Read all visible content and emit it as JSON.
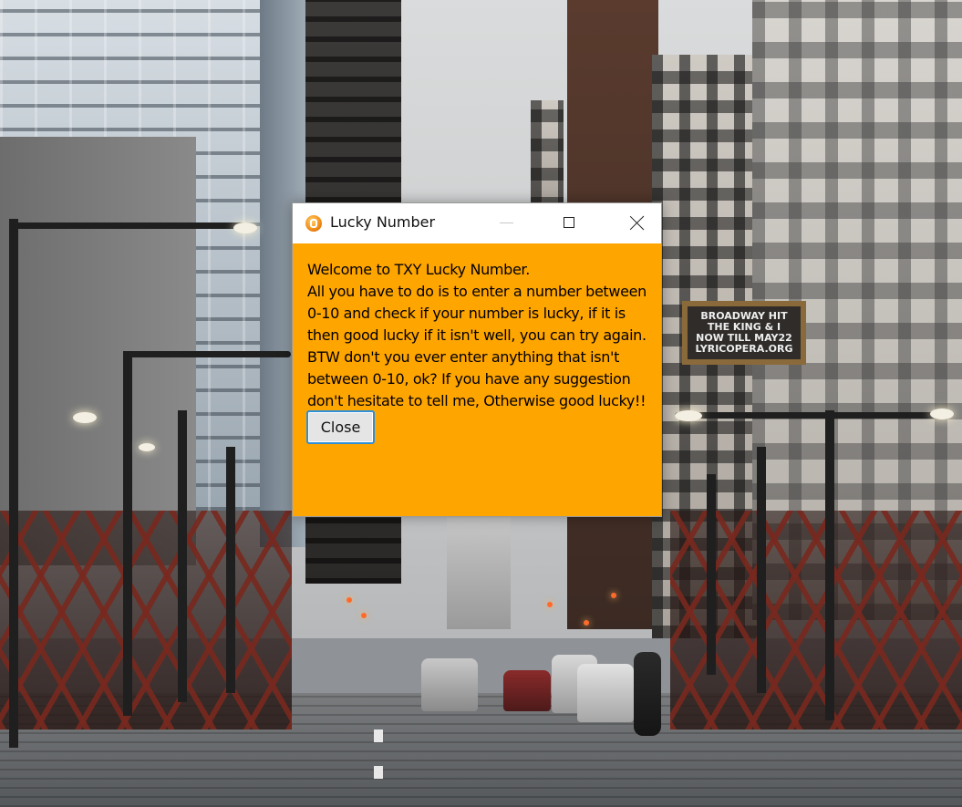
{
  "window": {
    "title": "Lucky Number",
    "background_color": "#FFA500",
    "controls": {
      "minimize": "minimize-icon",
      "maximize": "maximize-icon",
      "close": "close-icon"
    }
  },
  "dialog": {
    "message_lines": [
      "Welcome to TXY Lucky Number.",
      "All you have to do is to enter a number between",
      "0-10 and check if your number is lucky, if it is",
      "then good lucky if it isn't well, you can try again.",
      "BTW don't you ever enter anything that isn't",
      "between 0-10, ok? If you have any suggestion",
      "don't hesitate to tell me, Otherwise good lucky!!"
    ],
    "close_label": "Close"
  },
  "background": {
    "marquee": [
      "BROADWAY HIT",
      "THE KING & I",
      "NOW TILL MAY22",
      "LYRICOPERA.ORG"
    ]
  }
}
